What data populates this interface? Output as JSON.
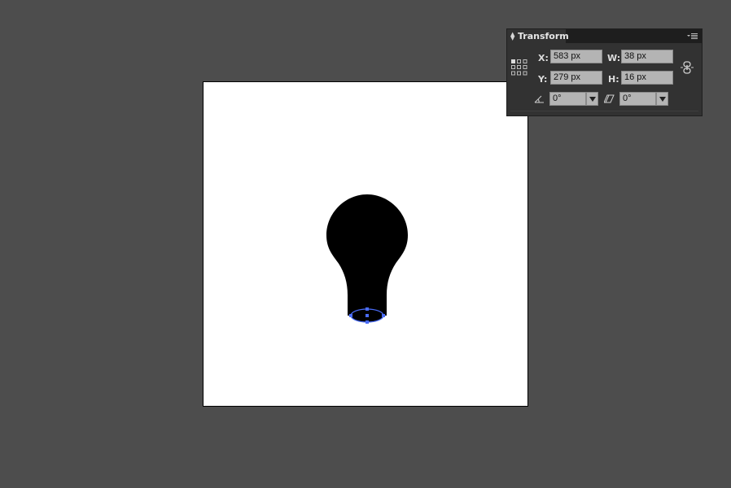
{
  "panel": {
    "title": "Transform",
    "x_label": "X:",
    "x_value": "583 px",
    "y_label": "Y:",
    "y_value": "279 px",
    "w_label": "W:",
    "w_value": "38 px",
    "h_label": "H:",
    "h_value": "16 px",
    "rotate_value": "0°",
    "shear_value": "0°",
    "icons": [
      "reference-point-icon",
      "panel-menu-icon",
      "constrain-proportions-icon",
      "rotate-icon",
      "shear-icon",
      "chevron-down-icon"
    ]
  },
  "canvas": {
    "object": "lightbulb-shape",
    "selection": "ellipse-selected"
  },
  "colors": {
    "workspace": "#4d4d4d",
    "artboard": "#ffffff",
    "shape_fill": "#000000",
    "selection": "#4a6cf7",
    "panel_bg": "#323232",
    "field_bg": "#b4b4b4"
  }
}
